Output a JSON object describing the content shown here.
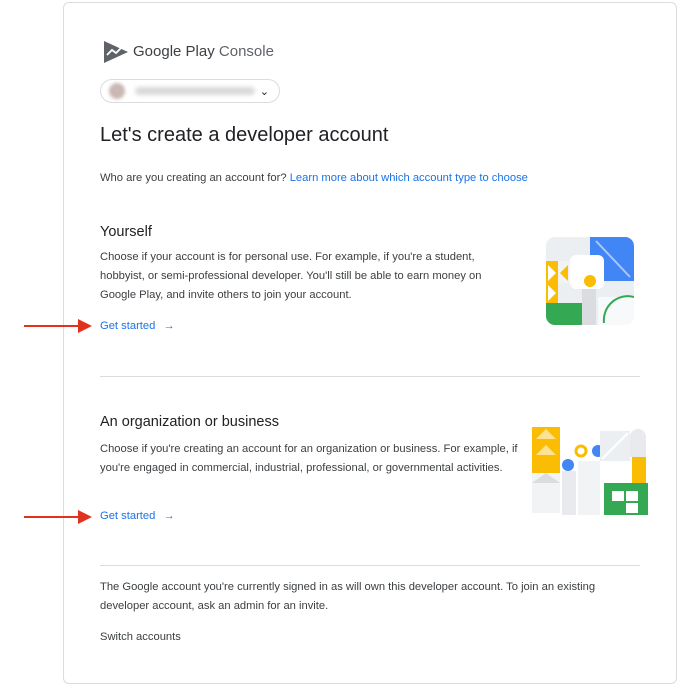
{
  "brand": {
    "name_strong": "Google Play",
    "name_light": "Console"
  },
  "account_chip": {
    "chevron": "⌄"
  },
  "page": {
    "title": "Let's create a developer account",
    "subtitle_prefix": "Who are you creating an account for?",
    "subtitle_link": "Learn more about which account type to choose"
  },
  "options": [
    {
      "heading": "Yourself",
      "description": "Choose if your account is for personal use. For example, if you're a student, hobbyist, or semi-professional developer. You'll still be able to earn money on Google Play, and invite others to join your account.",
      "cta": "Get started",
      "cta_arrow": "→",
      "illustration_icon": "personal-illustration"
    },
    {
      "heading": "An organization or business",
      "description": "Choose if you're creating an account for an organization or business. For example, if you're engaged in commercial, industrial, professional, or governmental activities.",
      "cta": "Get started",
      "cta_arrow": "→",
      "illustration_icon": "organization-illustration"
    }
  ],
  "footer": {
    "note": "The Google account you're currently signed in as will own this developer account. To join an existing developer account, ask an admin for an invite.",
    "switch_accounts": "Switch accounts"
  },
  "annotations": {
    "arrow_color": "#e0321f"
  },
  "colors": {
    "link": "#1a73e8",
    "google_blue": "#4285f4",
    "google_green": "#34a853",
    "google_yellow": "#fbbc04"
  }
}
